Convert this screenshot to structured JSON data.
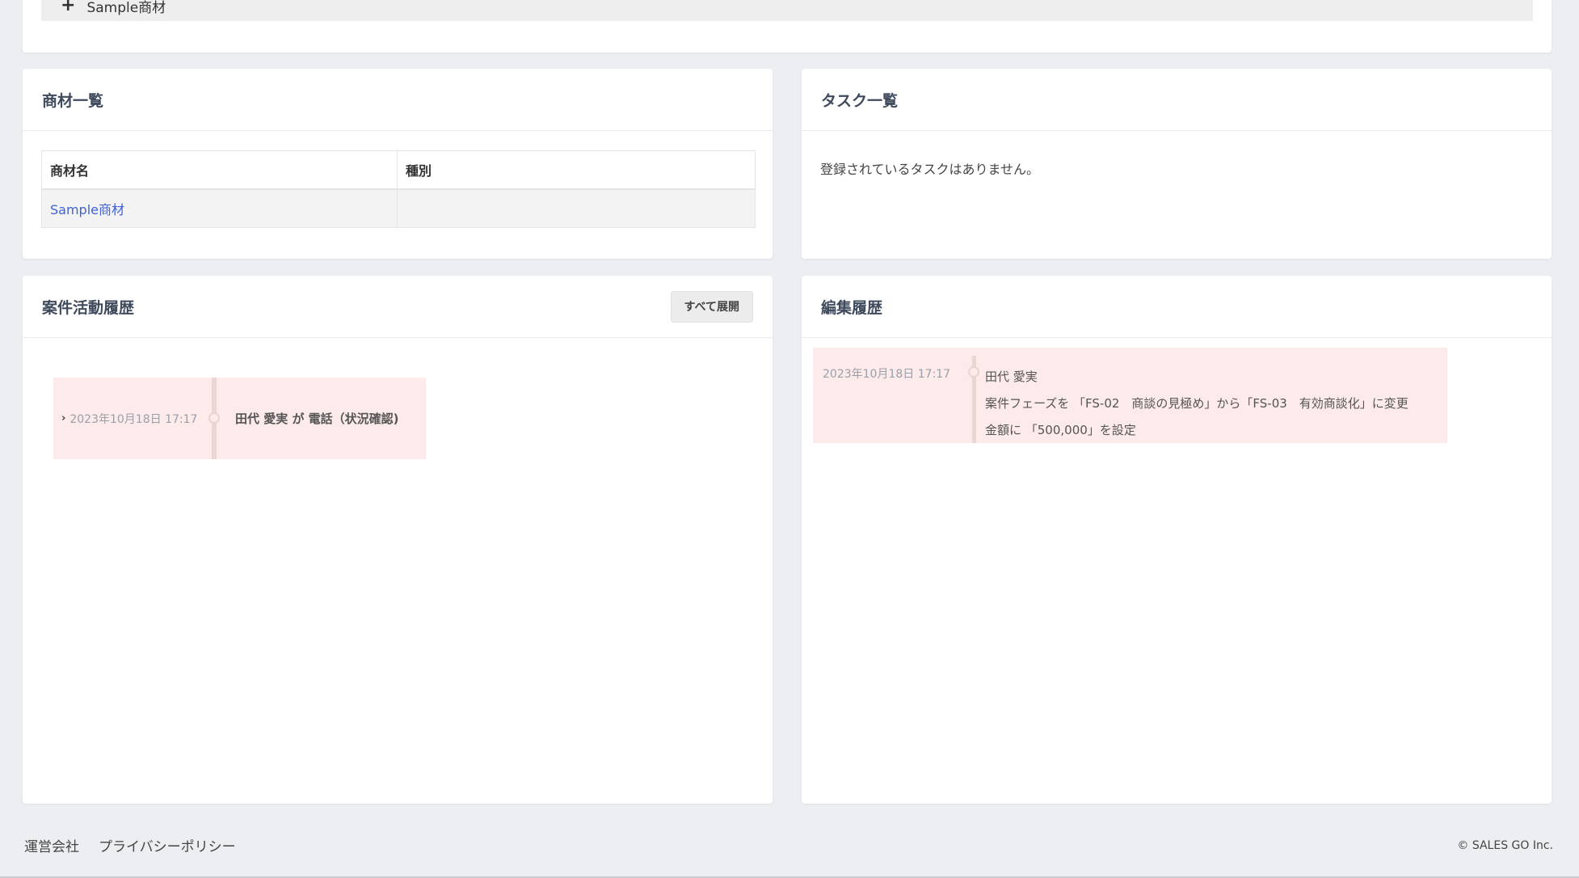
{
  "top_panel": {
    "plus_glyph": "+",
    "item_label": "Sample商材"
  },
  "materials": {
    "title": "商材一覧",
    "columns": [
      "商材名",
      "種別"
    ],
    "rows": [
      {
        "name": "Sample商材",
        "type": ""
      }
    ]
  },
  "tasks": {
    "title": "タスク一覧",
    "empty_message": "登録されているタスクはありません。"
  },
  "activity": {
    "title": "案件活動履歴",
    "expand_all_label": "すべて展開",
    "items": [
      {
        "chevron": "›",
        "date": "2023年10月18日 17:17",
        "text": "田代 愛実 が 電話（状況確認)"
      }
    ]
  },
  "edit_history": {
    "title": "編集履歴",
    "items": [
      {
        "date": "2023年10月18日 17:17",
        "user": "田代 愛実",
        "line1": "案件フェーズを 「FS-02　商談の見極め」から「FS-03　有効商談化」に変更",
        "line2": "金額に 「500,000」を設定"
      }
    ]
  },
  "footer": {
    "links": [
      "運営会社",
      "プライバシーポリシー"
    ],
    "copyright": "© SALES GO Inc."
  }
}
